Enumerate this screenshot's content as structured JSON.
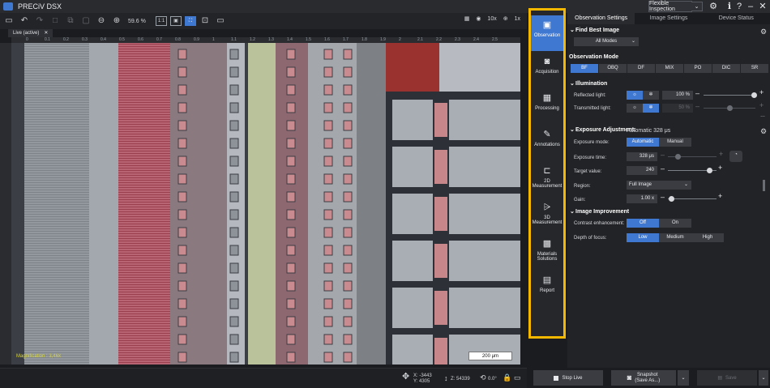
{
  "app": {
    "title": "PRECiV DSX",
    "mode": "Flexible Inspection"
  },
  "toolbar": {
    "zoom": "59.6 %",
    "right_items": [
      "10x",
      "1x"
    ]
  },
  "image_tab": {
    "label": "Live (active)"
  },
  "ruler": {
    "ticks": [
      "0",
      "0.1",
      "0.2",
      "0.3",
      "0.4",
      "0.5",
      "0.6",
      "0.7",
      "0.8",
      "0.9",
      "1",
      "1.1",
      "1.2",
      "1.3",
      "1.4",
      "1.5",
      "1.6",
      "1.7",
      "1.8",
      "1.9",
      "2",
      "2.1",
      "2.2",
      "2.3",
      "2.4",
      "2.5"
    ]
  },
  "image": {
    "magnification": "Magnification : 3,46x",
    "scalebar": "200 μm"
  },
  "status": {
    "x": "X: -3443",
    "y": "Y: 4305",
    "z": "Z: 54339",
    "angle": "0.0°"
  },
  "side_nav": [
    {
      "label": "Observation",
      "icon": "observation-icon",
      "active": true
    },
    {
      "label": "Acquisition",
      "icon": "camera-icon",
      "active": false
    },
    {
      "label": "Processing",
      "icon": "processing-icon",
      "active": false
    },
    {
      "label": "Annotations",
      "icon": "annotation-icon",
      "active": false
    },
    {
      "label": "2D\nMeasurement",
      "icon": "measure-2d-icon",
      "active": false
    },
    {
      "label": "3D\nMeasurement",
      "icon": "measure-3d-icon",
      "active": false
    },
    {
      "label": "Materials\nSolutions",
      "icon": "materials-icon",
      "active": false
    },
    {
      "label": "Report",
      "icon": "report-icon",
      "active": false
    }
  ],
  "panel": {
    "tabs": [
      "Observation Settings",
      "Image Settings",
      "Device Status"
    ],
    "find_best_image": {
      "title": "Find Best Image",
      "value": "All Modes"
    },
    "observation_mode": {
      "title": "Observation Mode",
      "modes": [
        "BF",
        "OBQ",
        "DF",
        "MIX",
        "PO",
        "DIC",
        "SR"
      ]
    },
    "illumination": {
      "title": "Illumination",
      "reflected_label": "Reflected light:",
      "reflected_value": "100 %",
      "transmitted_label": "Transmitted light:",
      "transmitted_value": "50 %"
    },
    "exposure": {
      "title": "Exposure Adjustment:",
      "subtitle": "Automatic 328 μs",
      "mode_label": "Exposure mode:",
      "mode_options": [
        "Automatic",
        "Manual"
      ],
      "time_label": "Exposure time:",
      "time_value": "328 μs",
      "target_label": "Target value:",
      "target_value": "240",
      "region_label": "Region:",
      "region_value": "Full Image",
      "gain_label": "Gain:",
      "gain_value": "1.00 x"
    },
    "image_improvement": {
      "title": "Image Improvement",
      "contrast_label": "Contrast enhancement:",
      "contrast_options": [
        "Off",
        "On"
      ],
      "depth_label": "Depth of focus:",
      "depth_options": [
        "Low",
        "Medium",
        "High"
      ]
    }
  },
  "actions": {
    "stop_live": "Stop Live",
    "snapshot": "Snapshot\n(Save As...)",
    "save": "Save"
  }
}
